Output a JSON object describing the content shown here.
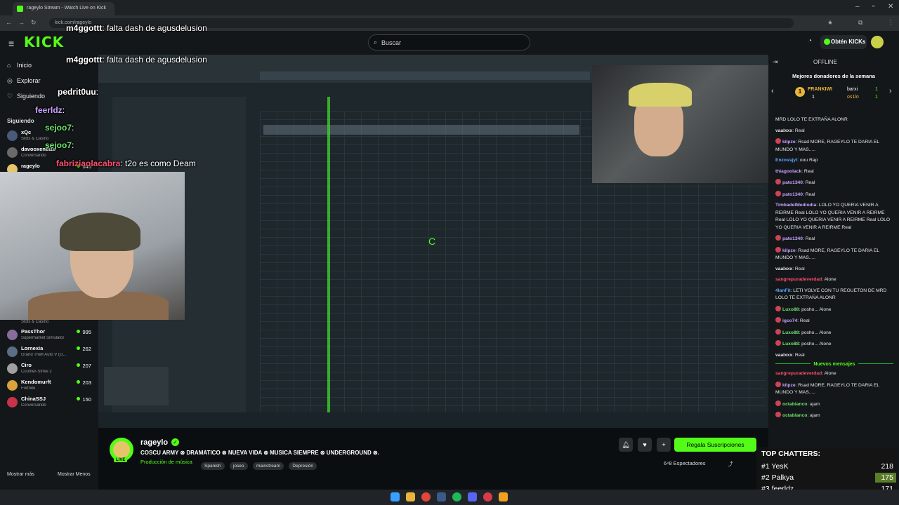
{
  "browser": {
    "tab_title": "rageylo Stream - Watch Live on Kick",
    "url": "kick.com/rageylo"
  },
  "header": {
    "logo": "KICK",
    "search_placeholder": "Buscar",
    "kicks_button": "Obtén KICKs"
  },
  "sidebar": {
    "nav": [
      {
        "label": "Inicio",
        "icon": "home-icon"
      },
      {
        "label": "Explorar",
        "icon": "compass-icon"
      },
      {
        "label": "Siguiendo",
        "icon": "heart-icon"
      }
    ],
    "following_label": "Siguiendo",
    "channels_top": [
      {
        "name": "xQc",
        "game": "Slots & Casino",
        "viewers": ""
      },
      {
        "name": "davooxeneize",
        "game": "Conversando",
        "viewers": ""
      },
      {
        "name": "rageylo",
        "game": "",
        "viewers": "645"
      }
    ],
    "channels": [
      {
        "name": "PassThor",
        "game": "Supermarket Simulator",
        "viewers": "995",
        "color": "#8a6b9e"
      },
      {
        "name": "Lornexia",
        "game": "Grand Theft Auto V (G...",
        "viewers": "262",
        "color": "#5a6e86"
      },
      {
        "name": "Ciro",
        "game": "Counter-Strike 2",
        "viewers": "207",
        "color": "#a0a0a0"
      },
      {
        "name": "Kendomurft",
        "game": "Fortnite",
        "viewers": "203",
        "color": "#d9a23a"
      },
      {
        "name": "ChinaSSJ",
        "game": "Conversando",
        "viewers": "150",
        "color": "#c8324a"
      }
    ],
    "slots_label": "Slots & Casino",
    "show_more": "Mostrar más",
    "show_less": "Mostrar Menos"
  },
  "overlay_chat": [
    {
      "user": "m4ggottt",
      "text": ": falta dash de agusdelusion",
      "color": "#ffffff"
    },
    {
      "user": "m4ggottt",
      "text": ": falta dash de agusdelusion",
      "color": "#ffffff"
    },
    {
      "user": "pedrit0uu",
      "text": ":",
      "color": "#ffffff"
    },
    {
      "user": "feerldz",
      "text": ":",
      "color": "#c9a2ff"
    },
    {
      "user": "sejoo7",
      "text": ":",
      "color": "#6de36a"
    },
    {
      "user": "sejoo7",
      "text": ":",
      "color": "#6de36a"
    },
    {
      "user": "fabriziaolacabra",
      "text": ": t2o es como Deam",
      "color": "#ff4d6d"
    }
  ],
  "stream_info": {
    "streamer": "rageylo",
    "live_tag": "LIVE",
    "title": "COSCU ARMY ⊗ DRAMATICO ⊗ NUEVA VIDA ⊗ MUSICA SIEMPRE ⊗ UNDERGROUND ⊗.",
    "category": "Producción de música",
    "tags": [
      "Spanish",
      "joseo",
      "mainstream",
      "Depresión"
    ],
    "gift_button": "Regala Suscripciones",
    "viewers_label": "Espectadores",
    "viewers_prefix": "6⁴8"
  },
  "chat": {
    "status": "OFFLINE",
    "donors_title": "Mejores donadores de la semana",
    "donors": [
      {
        "rank": "1",
        "name": "FRANKIWI",
        "amount": "1"
      },
      {
        "rank": "",
        "name": "barxi",
        "amount": "1"
      },
      {
        "rank": "",
        "name": "os1lo",
        "amount": "1"
      }
    ],
    "messages": [
      {
        "user": "",
        "text": "MRD LOLO TE EXTRAÑA ALONR",
        "color": "#e6e6e6",
        "badge": false
      },
      {
        "user": "vaalxxx",
        "text": ": Real",
        "color": "#e6e6e6",
        "badge": false
      },
      {
        "user": "kilpze",
        "text": ": Rsad MORE, RAGEYLO TE DARIA EL MUNDO Y MAS.....",
        "color": "#c9a2ff",
        "badge": true
      },
      {
        "user": "Enzossjyt",
        "text": ": oou Rap",
        "color": "#5aa8ff",
        "badge": false
      },
      {
        "user": "thiagoolack",
        "text": ": Real",
        "color": "#c9a2ff",
        "badge": false
      },
      {
        "user": "pato1340",
        "text": ": Real",
        "color": "#c9a2ff",
        "badge": true
      },
      {
        "user": "pato1340",
        "text": ": Real",
        "color": "#c9a2ff",
        "badge": true
      },
      {
        "user": "TimbadelMediodia",
        "text": ": LOLO YO QUERIA VENIR A REIRME Real LOLO YO QUERIA VENIR A REIRME Real LOLO YO QUERIA VENIR A REIRME Real LOLO YO QUERIA VENIR A REIRME Real",
        "color": "#c9a2ff",
        "badge": false
      },
      {
        "user": "pato1340",
        "text": ": Real",
        "color": "#c9a2ff",
        "badge": true
      },
      {
        "user": "kilpze",
        "text": ": Rsad MORE, RAGEYLO TE DARIA EL MUNDO Y MAS.....",
        "color": "#c9a2ff",
        "badge": true
      },
      {
        "user": "vaalxxx",
        "text": ": Real",
        "color": "#e6e6e6",
        "badge": false
      },
      {
        "user": "sangrepuradeverdad",
        "text": ": Alone",
        "color": "#ff4d6d",
        "badge": false
      },
      {
        "user": "4lanFit",
        "text": ": LETI VOLVE CON TU REGUETON DE MRD LOLO TE EXTRAÑA ALONR",
        "color": "#5aa8ff",
        "badge": false
      },
      {
        "user": "Luxo88",
        "text": ": posho... Alone",
        "color": "#6de36a",
        "badge": true
      },
      {
        "user": "igco74",
        "text": ": Real",
        "color": "#c9a2ff",
        "badge": true
      },
      {
        "user": "Luxo88",
        "text": ": posho... Alone",
        "color": "#6de36a",
        "badge": true
      },
      {
        "user": "Luxo88",
        "text": ": posho... Alone",
        "color": "#6de36a",
        "badge": true
      },
      {
        "user": "vaalxxx",
        "text": ": Real",
        "color": "#e6e6e6",
        "badge": false
      }
    ],
    "new_messages_label": "Nuevos mensajes",
    "new_messages": [
      {
        "user": "sangrepuradeverdad",
        "text": ": Alone",
        "color": "#ff4d6d",
        "badge": false
      },
      {
        "user": "kilpze",
        "text": ": Rsad MORE, RAGEYLO TE DARIA EL MUNDO Y MAS.....",
        "color": "#c9a2ff",
        "badge": true
      },
      {
        "user": "octablanco",
        "text": ": ajam",
        "color": "#6de36a",
        "badge": true
      },
      {
        "user": "octablanco",
        "text": ": ajam",
        "color": "#6de36a",
        "badge": true
      }
    ]
  },
  "top_chatters": {
    "title": "TOP CHATTERS:",
    "rows": [
      {
        "rank": "#1 YesK",
        "value": "218"
      },
      {
        "rank": "#2 Palkya",
        "value": "175"
      },
      {
        "rank": "#3 feerldz",
        "value": "171"
      }
    ]
  },
  "taskbar_icons": [
    "windows-icon",
    "search-icon",
    "chrome-icon",
    "folder-icon",
    "steam-icon",
    "spotify-icon",
    "discord-icon",
    "obs-icon",
    "fl-studio-icon"
  ]
}
